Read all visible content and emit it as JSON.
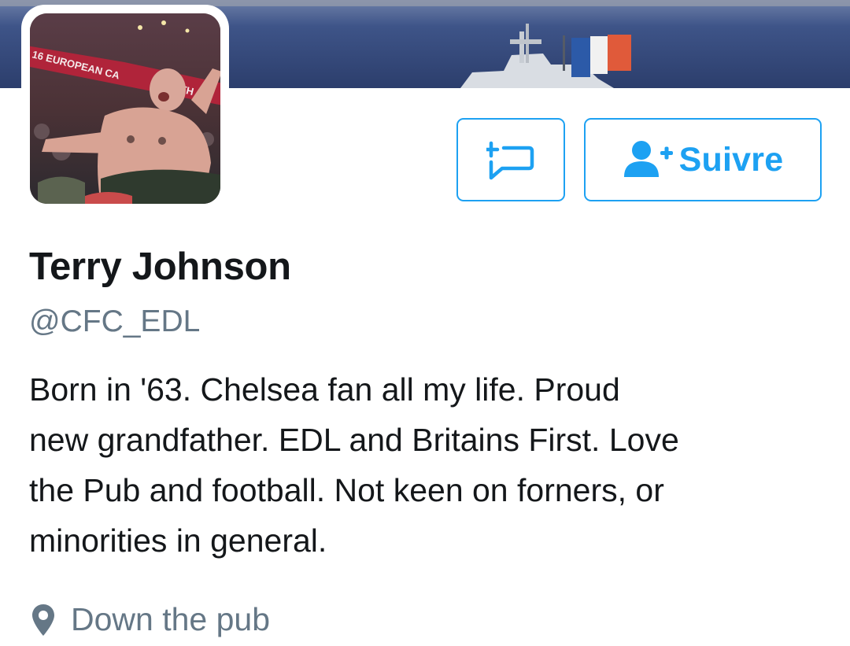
{
  "profile": {
    "name": "Terry Johnson",
    "handle": "@CFC_EDL",
    "bio_lines": [
      "Born in '63. Chelsea fan all my life. Proud",
      "new grandfather. EDL and Britains First. Love",
      "the Pub and football. Not keen on forners, or",
      "minorities in general."
    ],
    "location": "Down the pub"
  },
  "avatar": {
    "banner_text": "16 EUROPEAN CA",
    "banner_text_2": "TH"
  },
  "actions": {
    "message_icon": "new-message-icon",
    "follow_icon": "add-user-icon",
    "follow_label": "Suivre"
  },
  "icons": {
    "location": "location-pin-icon"
  },
  "colors": {
    "accent": "#1da1f2",
    "name_text": "#14171a",
    "secondary_text": "#657786",
    "background": "#ffffff"
  }
}
